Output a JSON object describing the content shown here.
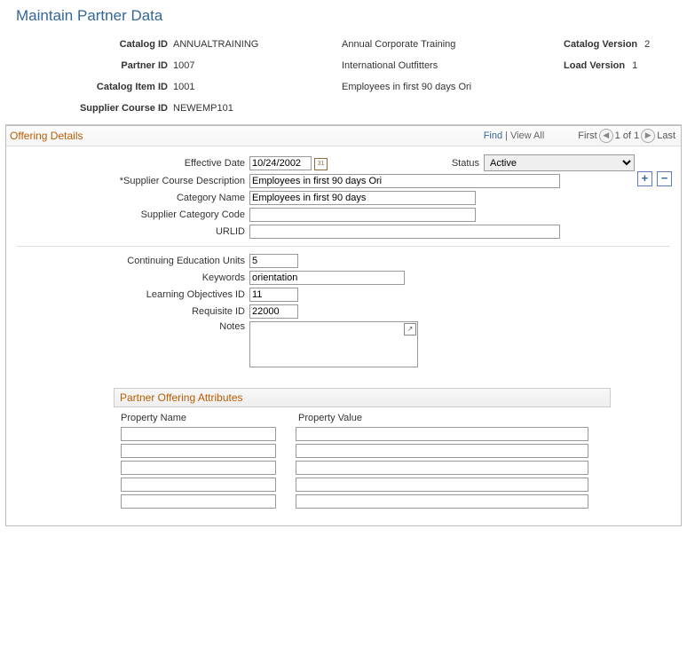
{
  "page_title": "Maintain Partner Data",
  "header": {
    "catalog_id_label": "Catalog ID",
    "catalog_id": "ANNUALTRAINING",
    "catalog_desc": "Annual Corporate Training",
    "catalog_version_label": "Catalog Version",
    "catalog_version": "2",
    "partner_id_label": "Partner ID",
    "partner_id": "1007",
    "partner_desc": "International Outfitters",
    "load_version_label": "Load Version",
    "load_version": "1",
    "catalog_item_id_label": "Catalog Item ID",
    "catalog_item_id": "1001",
    "catalog_item_desc": "Employees in first 90 days Ori",
    "supplier_course_id_label": "Supplier Course ID",
    "supplier_course_id": "NEWEMP101"
  },
  "section": {
    "title": "Offering Details",
    "find": "Find",
    "view_all": "View All",
    "first": "First",
    "counter": "1 of 1",
    "last": "Last"
  },
  "form": {
    "effective_date_label": "Effective Date",
    "effective_date": "10/24/2002",
    "status_label": "Status",
    "status": "Active",
    "supplier_course_desc_label": "*Supplier Course Description",
    "supplier_course_desc": "Employees in first 90 days Ori",
    "category_name_label": "Category Name",
    "category_name": "Employees in first 90 days",
    "supplier_category_code_label": "Supplier Category Code",
    "supplier_category_code": "",
    "urlid_label": "URLID",
    "urlid": "",
    "ceu_label": "Continuing Education Units",
    "ceu": "5",
    "keywords_label": "Keywords",
    "keywords": "orientation",
    "learning_obj_label": "Learning Objectives ID",
    "learning_obj": "11",
    "requisite_label": "Requisite ID",
    "requisite": "22000",
    "notes_label": "Notes",
    "notes": ""
  },
  "attributes": {
    "title": "Partner Offering Attributes",
    "col1": "Property Name",
    "col2": "Property Value",
    "rows": [
      {
        "name": "",
        "value": ""
      },
      {
        "name": "",
        "value": ""
      },
      {
        "name": "",
        "value": ""
      },
      {
        "name": "",
        "value": ""
      },
      {
        "name": "",
        "value": ""
      }
    ]
  }
}
